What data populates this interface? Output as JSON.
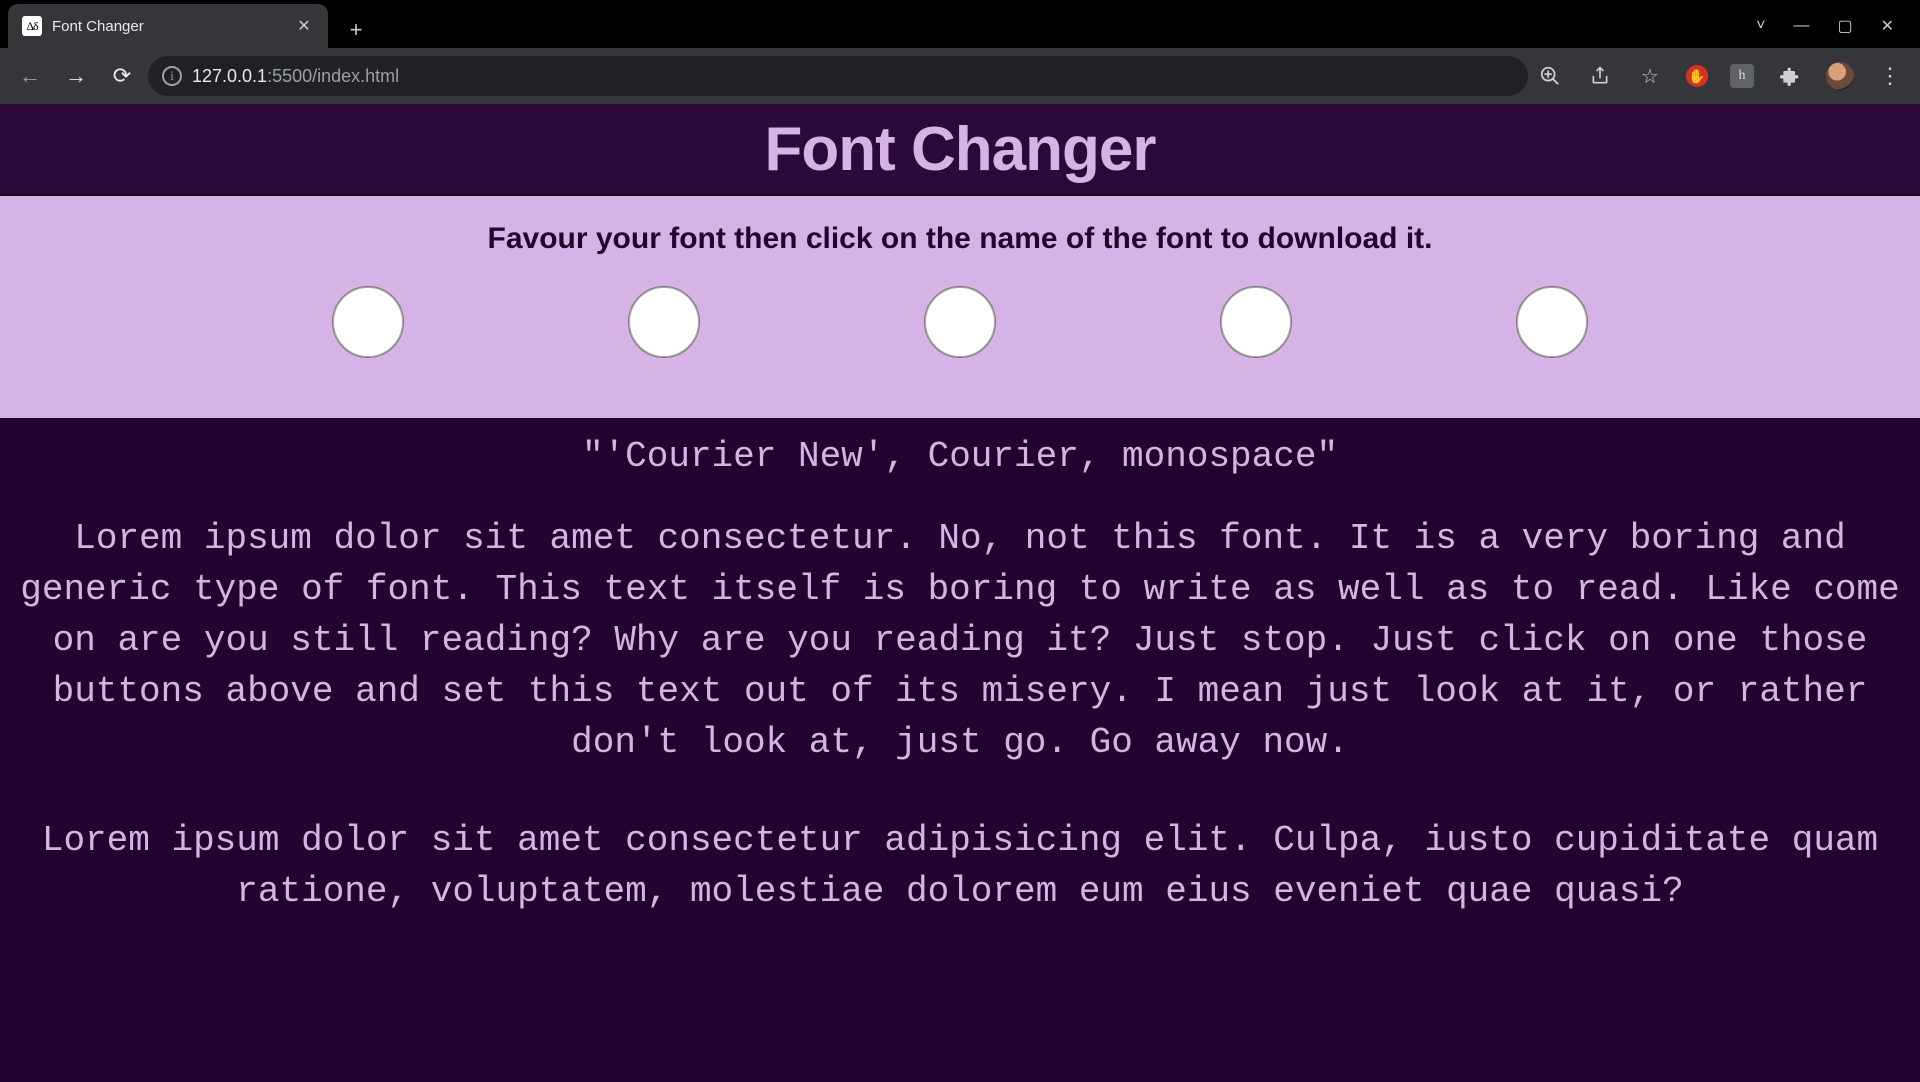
{
  "browser": {
    "tab_title": "Font Changer",
    "favicon_text": "Δδ",
    "url_host": "127.0.0.1",
    "url_port": ":5500",
    "url_path": "/index.html"
  },
  "page": {
    "title": "Font Changer",
    "instruction": "Favour your font then click on the name of the font to download it.",
    "font_buttons": [
      "font-1",
      "font-2",
      "font-3",
      "font-4",
      "font-5"
    ],
    "current_font_display": "\"'Courier New', Courier, monospace\"",
    "paragraph_1": "Lorem ipsum dolor sit amet consectetur. No, not this font. It is a very boring and generic type of font. This text itself is boring to write as well as to read. Like come on are you still reading? Why are you reading it? Just stop. Just click on one those buttons above and set this text out of its misery. I mean just look at it, or rather don't look at, just go. Go away now.",
    "paragraph_2": "Lorem ipsum dolor sit amet consectetur adipisicing elit. Culpa, iusto cupiditate quam ratione, voluptatem, molestiae dolorem eum eius eveniet quae quasi?"
  },
  "colors": {
    "header_bg": "#2b0a3a",
    "panel_bg": "#d6b3e6",
    "content_bg": "#23042f",
    "text_light": "#d6b3e6"
  }
}
